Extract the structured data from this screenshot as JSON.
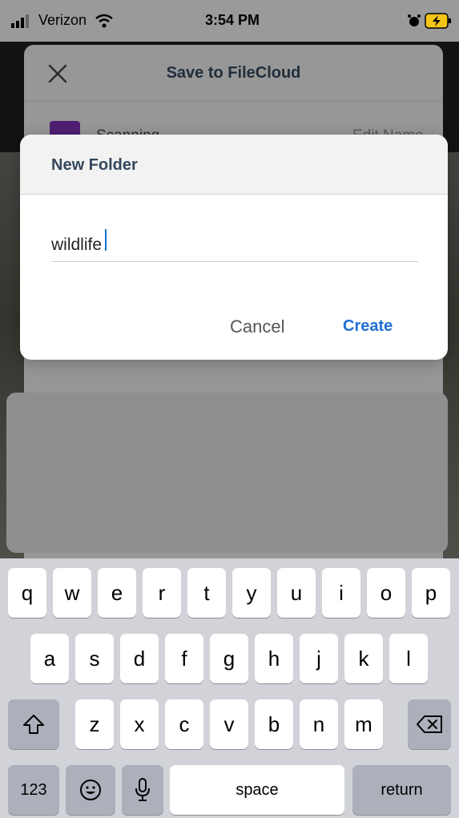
{
  "status_bar": {
    "carrier": "Verizon",
    "time": "3:54 PM"
  },
  "sheet": {
    "title": "Save to FileCloud",
    "file_name": "Scanning",
    "edit_name_label": "Edit Name"
  },
  "dialog": {
    "title": "New Folder",
    "input_value": "wildlife",
    "cancel_label": "Cancel",
    "create_label": "Create"
  },
  "keyboard": {
    "row1": [
      "q",
      "w",
      "e",
      "r",
      "t",
      "y",
      "u",
      "i",
      "o",
      "p"
    ],
    "row2": [
      "a",
      "s",
      "d",
      "f",
      "g",
      "h",
      "j",
      "k",
      "l"
    ],
    "row3": [
      "z",
      "x",
      "c",
      "v",
      "b",
      "n",
      "m"
    ],
    "numbers_label": "123",
    "space_label": "space",
    "return_label": "return"
  },
  "colors": {
    "accent": "#1f6fd6",
    "title": "#33475b"
  }
}
